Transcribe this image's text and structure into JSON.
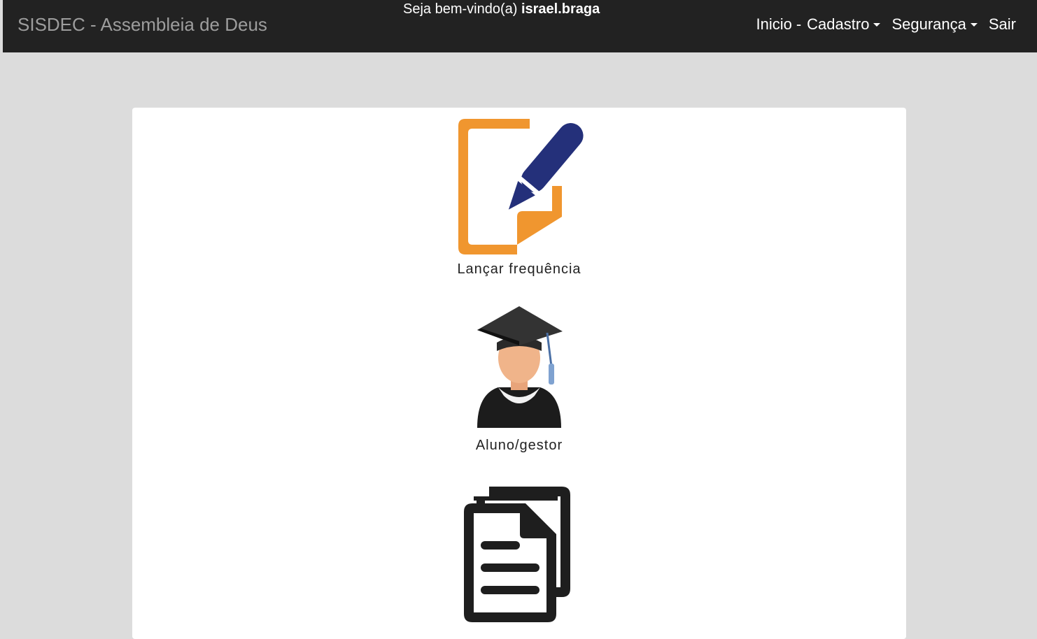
{
  "navbar": {
    "brand": "SISDEC - Assembleia de Deus",
    "welcome_prefix": "Seja bem-vindo(a) ",
    "welcome_user": "israel.braga",
    "menu": {
      "inicio": "Inicio",
      "sep": "-",
      "cadastro": "Cadastro",
      "seguranca": "Segurança",
      "sair": "Sair"
    }
  },
  "tiles": [
    {
      "label": "Lançar frequência",
      "icon": "edit-document-icon"
    },
    {
      "label": "Aluno/gestor",
      "icon": "graduate-student-icon"
    },
    {
      "label": "",
      "icon": "documents-icon"
    }
  ],
  "colors": {
    "navbar_bg": "#222222",
    "page_bg": "#dcdcdc",
    "orange": "#f0962f",
    "navy": "#24307a"
  }
}
